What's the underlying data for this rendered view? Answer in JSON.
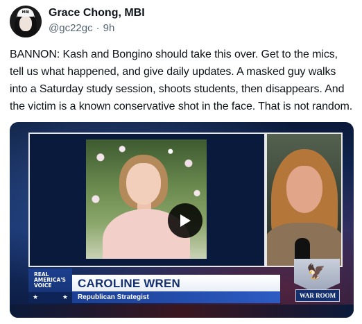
{
  "post": {
    "author_name": "Grace Chong, MBI",
    "handle": "@gc22gc",
    "separator": "·",
    "time": "9h",
    "avatar_cap_text": "MBI",
    "text": "BANNON: Kash and Bongino should take this over. Get to the mics, tell us what happened, and give daily updates. A masked guy walks into a Saturday study session, shoots students, then disappears. And the victim is a known conservative shot in the face. That is not random."
  },
  "video": {
    "network_logo": "REAL AMERICA'S VOICE",
    "guest_name": "CAROLINE WREN",
    "guest_title": "Republican Strategist",
    "show_logo": "WAR ROOM",
    "play_icon": "play-icon"
  },
  "colors": {
    "text_primary": "#0f1419",
    "text_secondary": "#536471",
    "lower_third_blue": "#1b3f93"
  }
}
